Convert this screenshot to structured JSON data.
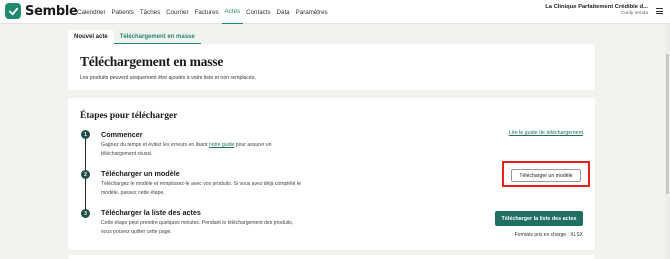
{
  "app": {
    "logo_text": "Semble",
    "brand_color": "#1f8a70"
  },
  "nav": {
    "items": [
      {
        "label": "Calendrier"
      },
      {
        "label": "Patients"
      },
      {
        "label": "Tâches"
      },
      {
        "label": "Courrier"
      },
      {
        "label": "Factures"
      },
      {
        "label": "Actes",
        "active": true
      },
      {
        "label": "Contacts"
      },
      {
        "label": "Data"
      },
      {
        "label": "Paramètres"
      }
    ]
  },
  "account": {
    "clinic_name": "La Clinique Parfaitement Crédible d...",
    "user_name": "Cindy Iemda"
  },
  "tabs": [
    {
      "label": "Nouvel acte"
    },
    {
      "label": "Téléchargement en masse",
      "active": true
    }
  ],
  "header": {
    "title": "Téléchargement en masse",
    "subtitle": "Les produits peuvent uniquement être ajoutés à votre liste et non remplacés."
  },
  "steps_section": {
    "title": "Étapes pour télécharger",
    "guide_link": "Lire le guide de téléchargement",
    "steps": [
      {
        "number": "1",
        "title": "Commencer",
        "desc_before": "Gagnez du temps et évitez les erreurs en lisant ",
        "desc_link": "notre guide",
        "desc_after": " pour assurer un téléchargement réussi."
      },
      {
        "number": "2",
        "title": "Télécharger un modèle",
        "desc": "Téléchargez le modèle et remplissez-le avec vos produits. Si vous avez déjà complété le modèle, passez cette étape."
      },
      {
        "number": "3",
        "title": "Télécharger la liste des actes",
        "desc": "Cette étape peut prendre quelques minutes. Pendant le téléchargement des produits, vous pouvez quitter cette page."
      }
    ],
    "download_template_button": "Télécharger un modèle",
    "upload_list_button": "Télécharger la liste des actes",
    "formats_text": "Formats pris en charge : XLSX"
  }
}
